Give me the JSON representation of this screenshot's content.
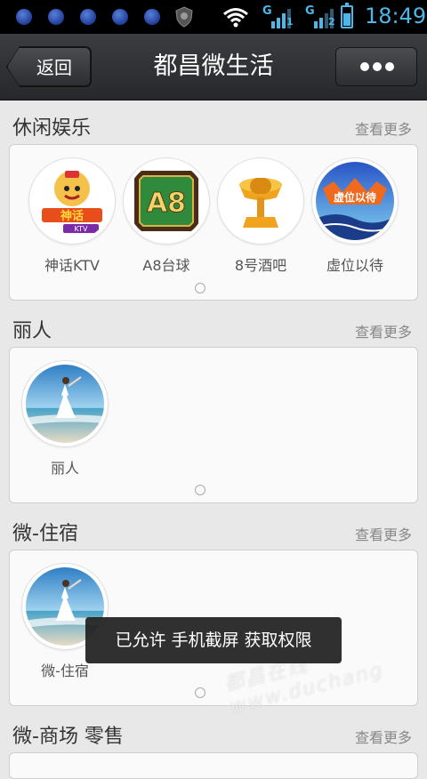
{
  "status_bar": {
    "sim1_label": "1",
    "sim2_label": "2",
    "time": "18:49",
    "icons": [
      "notification-icon",
      "notification-icon",
      "notification-icon",
      "notification-icon",
      "notification-icon",
      "shield-icon",
      "wifi-icon",
      "signal-icon",
      "signal-icon",
      "battery-icon"
    ]
  },
  "header": {
    "back_label": "返回",
    "title": "都昌微生活",
    "more_icon": "more-dots-icon"
  },
  "sections": [
    {
      "title": "休闲娱乐",
      "more": "查看更多",
      "items": [
        {
          "label": "神话KTV",
          "icon": "ktv-logo"
        },
        {
          "label": "A8台球",
          "icon": "a8-billiards-logo"
        },
        {
          "label": "8号酒吧",
          "icon": "bar-microphone-logo"
        },
        {
          "label": "虚位以待",
          "icon": "placeholder-logo"
        }
      ]
    },
    {
      "title": "丽人",
      "more": "查看更多",
      "items": [
        {
          "label": "丽人",
          "icon": "beach-woman-photo"
        }
      ]
    },
    {
      "title": "微-住宿",
      "more": "查看更多",
      "items": [
        {
          "label": "微-住宿",
          "icon": "beach-woman-photo"
        }
      ]
    },
    {
      "title": "微-商场 零售",
      "more": "查看更多",
      "items": []
    }
  ],
  "toast": "已允许 手机截屏 获取权限",
  "watermark": "都昌在线 www.duchang"
}
